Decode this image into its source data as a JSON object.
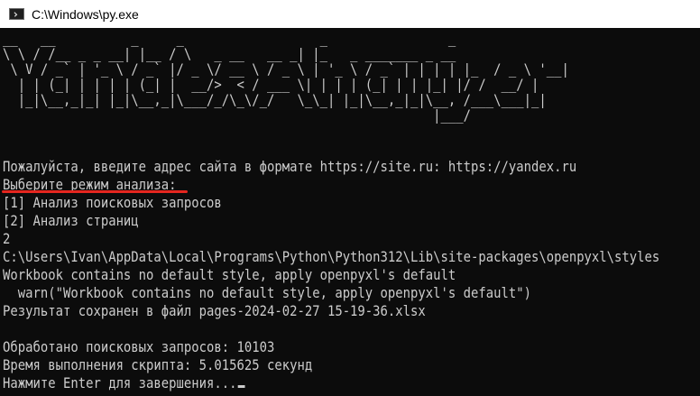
{
  "window": {
    "title": "C:\\Windows\\py.exe",
    "icon": "console-app-icon"
  },
  "console": {
    "background": "#0c0c0c",
    "foreground": "#cccccc",
    "banner": [
      "__   __          _     _                  _                _                         ",
      "\\ \\ / /__ _ _ __| |__ / \\   _ __   __ _| |_   _ _______ _ __ ",
      " \\ V / _` | '_ \\ / _` |/ _ \\/ __ \\ / _ \\ | '_ \\ / _` | | | | |_  / _ \\ '__|",
      "  | | (_| | | | | (_| |  __/>  < / ___ \\| | | | (_| | | |_| |/ /  __/ |   ",
      "  |_|\\__,_|_| |_|\\__,_|\\___/_/\\_\\/_/   \\_\\_| |_|\\__,_|_|\\__, /___\\___|_|   ",
      "                                                         |___/              "
    ],
    "lines": [
      "Пожалуйста, введите адрес сайта в формате https://site.ru: https://yandex.ru",
      "Выберите режим анализа:",
      "[1] Анализ поисковых запросов",
      "[2] Анализ страниц",
      "2",
      "C:\\Users\\Ivan\\AppData\\Local\\Programs\\Python\\Python312\\Lib\\site-packages\\openpyxl\\styles",
      "Workbook contains no default style, apply openpyxl's default",
      "  warn(\"Workbook contains no default style, apply openpyxl's default\")",
      "Результат сохранен в файл pages-2024-02-27 15-19-36.xlsx",
      "",
      "Обработано поисковых запросов: 10103",
      "Время выполнения скрипта: 5.015625 секунд",
      "Нажмите Enter для завершения..."
    ]
  },
  "annotation": {
    "color": "#e5261f"
  }
}
